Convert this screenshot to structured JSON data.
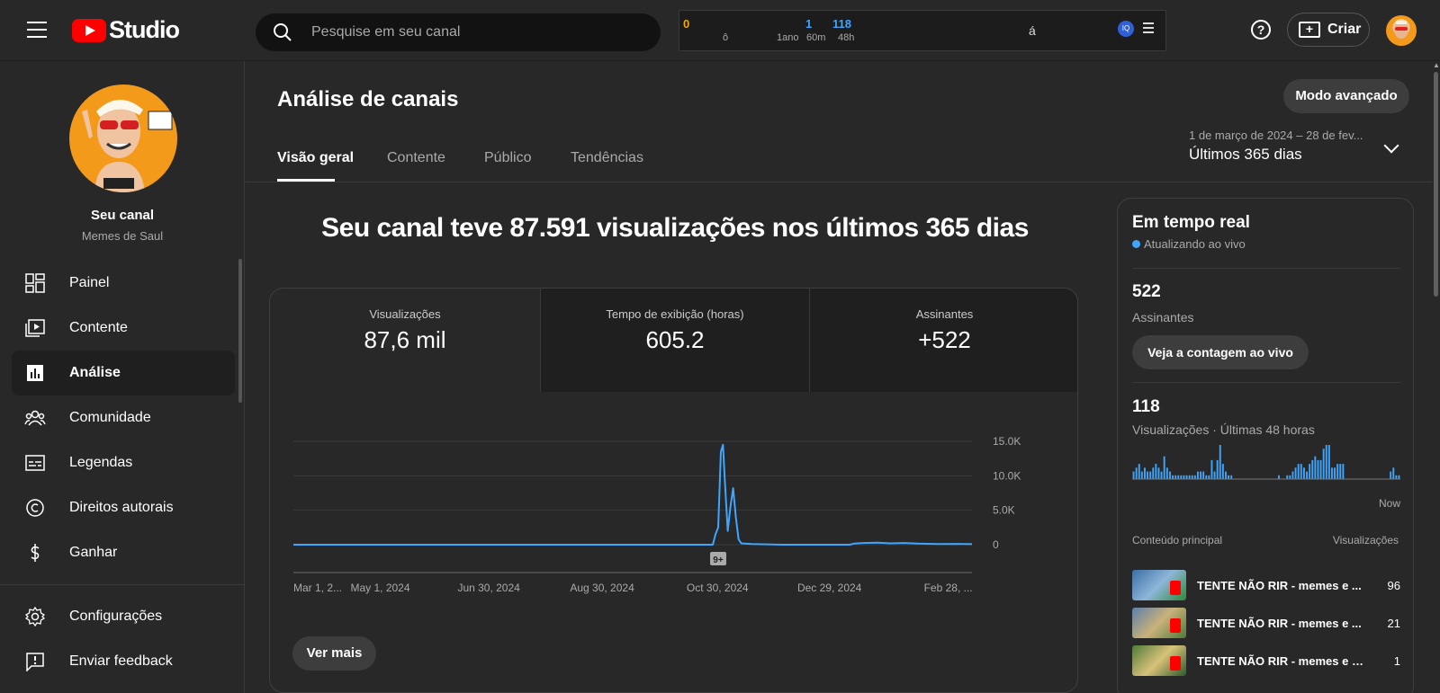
{
  "app": {
    "logo_text": "Studio"
  },
  "search": {
    "placeholder": "Pesquise em seu canal"
  },
  "extension": {
    "v1": "0",
    "v1_sub": "ô",
    "v2": "1",
    "v2_sub": "1ano",
    "v3_sub": "60m",
    "v4": "118",
    "v4_sub": "48h",
    "mid": "á",
    "icon_label": "IQ"
  },
  "header": {
    "help_label": "?",
    "create_label": "Criar"
  },
  "sidebar": {
    "channel_title": "Seu canal",
    "channel_name": "Memes de Saul",
    "items": [
      {
        "label": "Painel",
        "icon": "dashboard-icon"
      },
      {
        "label": "Contente",
        "icon": "content-icon"
      },
      {
        "label": "Análise",
        "icon": "analytics-icon"
      },
      {
        "label": "Comunidade",
        "icon": "community-icon"
      },
      {
        "label": "Legendas",
        "icon": "subtitles-icon"
      },
      {
        "label": "Direitos autorais",
        "icon": "copyright-icon"
      },
      {
        "label": "Ganhar",
        "icon": "dollar-icon"
      }
    ],
    "bottom_items": [
      {
        "label": "Configurações",
        "icon": "gear-icon"
      },
      {
        "label": "Enviar feedback",
        "icon": "feedback-icon"
      }
    ]
  },
  "main": {
    "title": "Análise de canais",
    "advanced_label": "Modo avançado",
    "tabs": [
      {
        "label": "Visão geral"
      },
      {
        "label": "Contente"
      },
      {
        "label": "Público"
      },
      {
        "label": "Tendências"
      }
    ],
    "date_range": "1 de março de 2024 – 28 de fev...",
    "date_label": "Últimos 365 dias",
    "headline": "Seu canal teve 87.591 visualizações nos últimos 365 dias",
    "metrics": [
      {
        "label": "Visualizações",
        "value": "87,6 mil"
      },
      {
        "label": "Tempo de exibição (horas)",
        "value": "605.2"
      },
      {
        "label": "Assinantes",
        "value": "+522"
      }
    ],
    "see_more_label": "Ver mais",
    "marker_label": "9+"
  },
  "realtime": {
    "title": "Em tempo real",
    "live_label": "Atualizando ao vivo",
    "subscribers_value": "522",
    "subscribers_label": "Assinantes",
    "live_count_button": "Veja a contagem ao vivo",
    "views_value": "118",
    "views_label": "Visualizações · Últimas 48 horas",
    "now_label": "Now",
    "top_content_header": "Conteúdo principal",
    "top_views_header": "Visualizações",
    "top_content": [
      {
        "title": "TENTE NÃO RIR - memes e ...",
        "views": "96"
      },
      {
        "title": "TENTE NÃO RIR - memes e ...",
        "views": "21"
      },
      {
        "title": "TENTE NÃO RIR - memes e VI...",
        "views": "1"
      }
    ],
    "bar_color": "#3ea6ff",
    "bars": [
      2,
      3,
      4,
      2,
      3,
      2,
      2,
      3,
      4,
      3,
      2,
      6,
      3,
      2,
      1,
      1,
      1,
      1,
      1,
      1,
      1,
      1,
      1,
      2,
      2,
      2,
      1,
      1,
      5,
      2,
      5,
      9,
      4,
      2,
      1,
      1,
      0,
      0,
      0,
      0,
      0,
      0,
      0,
      0,
      0,
      0,
      0,
      0,
      0,
      0,
      0,
      0,
      1,
      0,
      0,
      1,
      1,
      2,
      3,
      4,
      4,
      3,
      2,
      4,
      5,
      6,
      5,
      5,
      8,
      9,
      9,
      3,
      3,
      4,
      4,
      4,
      0,
      0,
      0,
      0,
      0,
      0,
      0,
      0,
      0,
      0,
      0,
      0,
      0,
      0,
      0,
      0,
      2,
      3,
      1,
      1
    ]
  },
  "chart_data": {
    "type": "line",
    "series_color": "#3ea6ff",
    "x_tick_labels": [
      "Mar 1, 2...",
      "May 1, 2024",
      "Jun 30, 2024",
      "Aug 30, 2024",
      "Oct 30, 2024",
      "Dec 29, 2024",
      "Feb 28, ..."
    ],
    "y_tick_labels": [
      "15.0K",
      "10.0K",
      "5.0K",
      "0"
    ],
    "ylim": [
      0,
      15000
    ],
    "points": [
      [
        0,
        0
      ],
      [
        0.618,
        0
      ],
      [
        0.622,
        1500
      ],
      [
        0.626,
        2500
      ],
      [
        0.63,
        13500
      ],
      [
        0.633,
        14500
      ],
      [
        0.636,
        9000
      ],
      [
        0.64,
        2000
      ],
      [
        0.644,
        5500
      ],
      [
        0.648,
        8200
      ],
      [
        0.652,
        4000
      ],
      [
        0.656,
        800
      ],
      [
        0.66,
        200
      ],
      [
        0.675,
        100
      ],
      [
        0.72,
        0
      ],
      [
        0.82,
        0
      ],
      [
        0.826,
        150
      ],
      [
        0.84,
        250
      ],
      [
        0.86,
        300
      ],
      [
        0.88,
        200
      ],
      [
        0.9,
        250
      ],
      [
        0.92,
        150
      ],
      [
        0.95,
        100
      ],
      [
        0.98,
        120
      ],
      [
        1.0,
        80
      ]
    ]
  }
}
